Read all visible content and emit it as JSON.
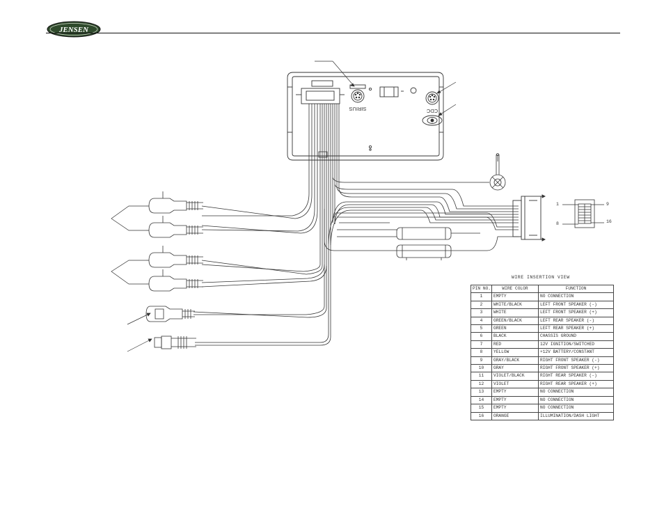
{
  "brand": {
    "logo_text": "JENSEN"
  },
  "head_unit": {
    "sirius_label": "SIRIUS",
    "cdc_label": "CDC"
  },
  "connector": {
    "pin_1": "1",
    "pin_9": "9",
    "pin_8": "8",
    "pin_16": "16"
  },
  "wiring_table": {
    "title": "WIRE INSERTION VIEW",
    "columns": [
      "PIN NO.",
      "WIRE COLOR",
      "FUNCTION"
    ],
    "rows": [
      {
        "pin": "1",
        "color": "EMPTY",
        "function": "NO CONNECTION"
      },
      {
        "pin": "2",
        "color": "WHITE/BLACK",
        "function": "LEFT FRONT SPEAKER (-)"
      },
      {
        "pin": "3",
        "color": "WHITE",
        "function": "LEFT FRONT SPEAKER (+)"
      },
      {
        "pin": "4",
        "color": "GREEN/BLACK",
        "function": "LEFT REAR SPEAKER (-)"
      },
      {
        "pin": "5",
        "color": "GREEN",
        "function": "LEFT REAR SPEAKER (+)"
      },
      {
        "pin": "6",
        "color": "BLACK",
        "function": "CHASSIS GROUND"
      },
      {
        "pin": "7",
        "color": "RED",
        "function": "12V IGNITION/SWITCHED"
      },
      {
        "pin": "8",
        "color": "YELLOW",
        "function": "+12V BATTERY/CONSTANT"
      },
      {
        "pin": "9",
        "color": "GRAY/BLACK",
        "function": "RIGHT FRONT SPEAKER (-)"
      },
      {
        "pin": "10",
        "color": "GRAY",
        "function": "RIGHT FRONT SPEAKER (+)"
      },
      {
        "pin": "11",
        "color": "VIOLET/BLACK",
        "function": "RIGHT REAR SPEAKER (-)"
      },
      {
        "pin": "12",
        "color": "VIOLET",
        "function": "RIGHT REAR SPEAKER (+)"
      },
      {
        "pin": "13",
        "color": "EMPTY",
        "function": "NO CONNECTION"
      },
      {
        "pin": "14",
        "color": "EMPTY",
        "function": "NO CONNECTION"
      },
      {
        "pin": "15",
        "color": "EMPTY",
        "function": "NO CONNECTION"
      },
      {
        "pin": "16",
        "color": "ORANGE",
        "function": "ILLUMINATION/DASH LIGHT"
      }
    ]
  }
}
